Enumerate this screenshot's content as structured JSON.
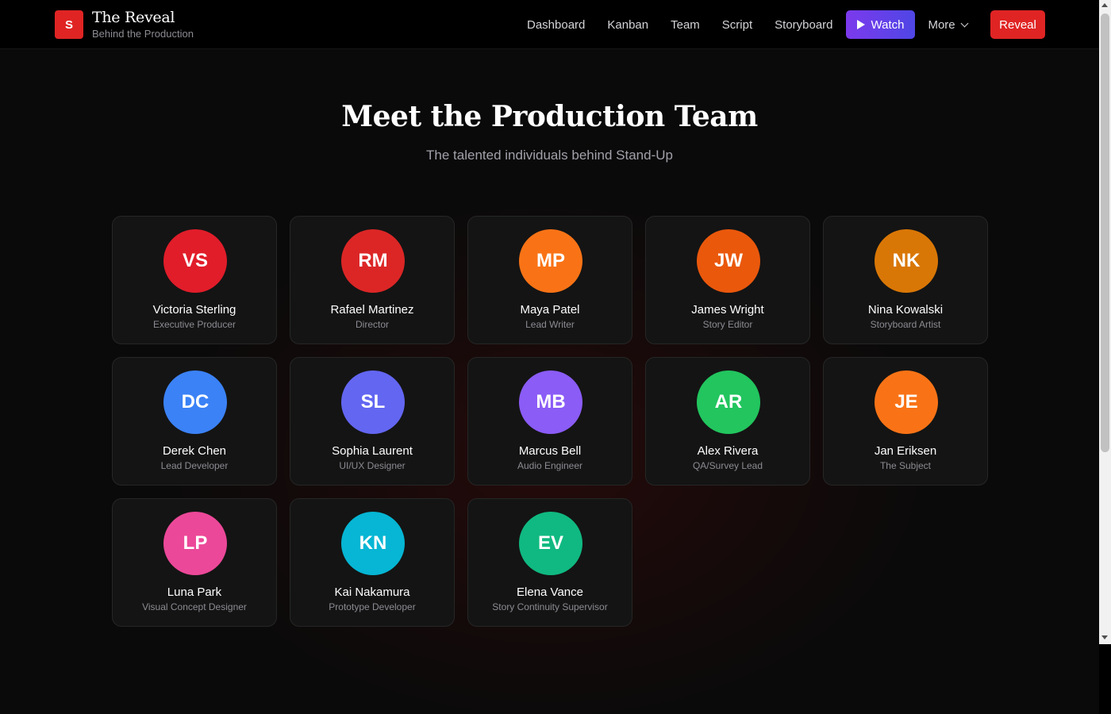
{
  "brand": {
    "logo_letter": "S",
    "title": "The Reveal",
    "subtitle": "Behind the Production",
    "accent_color": "#e02424"
  },
  "nav": {
    "links": [
      "Dashboard",
      "Kanban",
      "Team",
      "Script",
      "Storyboard"
    ],
    "watch_label": "Watch",
    "watch_icon": "play-icon",
    "more_label": "More",
    "more_icon": "chevron-down-icon",
    "reveal_label": "Reveal"
  },
  "header": {
    "title": "Meet the Production Team",
    "subtitle": "The talented individuals behind Stand-Up"
  },
  "team": [
    {
      "initials": "VS",
      "name": "Victoria Sterling",
      "role": "Executive Producer",
      "color": "#e11d2a"
    },
    {
      "initials": "RM",
      "name": "Rafael Martinez",
      "role": "Director",
      "color": "#dc2626"
    },
    {
      "initials": "MP",
      "name": "Maya Patel",
      "role": "Lead Writer",
      "color": "#f97316"
    },
    {
      "initials": "JW",
      "name": "James Wright",
      "role": "Story Editor",
      "color": "#ea580c"
    },
    {
      "initials": "NK",
      "name": "Nina Kowalski",
      "role": "Storyboard Artist",
      "color": "#d97706"
    },
    {
      "initials": "DC",
      "name": "Derek Chen",
      "role": "Lead Developer",
      "color": "#3b82f6"
    },
    {
      "initials": "SL",
      "name": "Sophia Laurent",
      "role": "UI/UX Designer",
      "color": "#6366f1"
    },
    {
      "initials": "MB",
      "name": "Marcus Bell",
      "role": "Audio Engineer",
      "color": "#8b5cf6"
    },
    {
      "initials": "AR",
      "name": "Alex Rivera",
      "role": "QA/Survey Lead",
      "color": "#22c55e"
    },
    {
      "initials": "JE",
      "name": "Jan Eriksen",
      "role": "The Subject",
      "color": "#f97316"
    },
    {
      "initials": "LP",
      "name": "Luna Park",
      "role": "Visual Concept Designer",
      "color": "#ec4899"
    },
    {
      "initials": "KN",
      "name": "Kai Nakamura",
      "role": "Prototype Developer",
      "color": "#06b6d4"
    },
    {
      "initials": "EV",
      "name": "Elena Vance",
      "role": "Story Continuity Supervisor",
      "color": "#10b981"
    }
  ]
}
